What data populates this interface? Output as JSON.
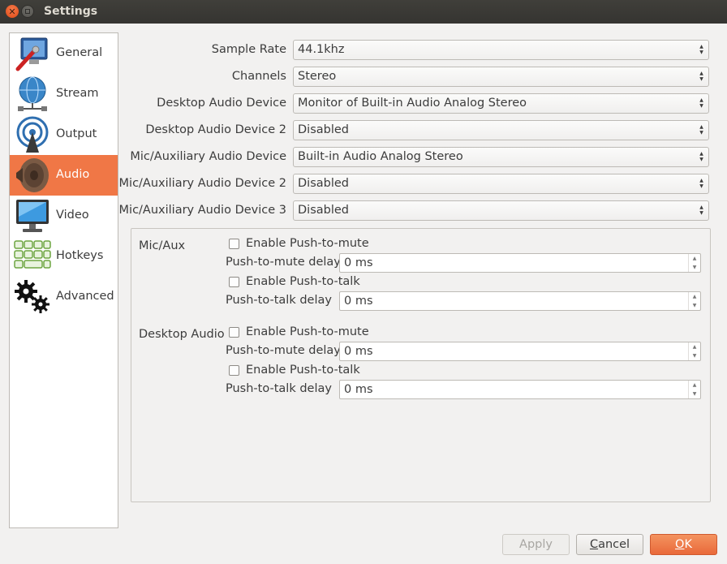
{
  "window": {
    "title": "Settings"
  },
  "sidebar": {
    "items": [
      {
        "label": "General",
        "icon": "monitor-wrench-icon",
        "active": false
      },
      {
        "label": "Stream",
        "icon": "globe-network-icon",
        "active": false
      },
      {
        "label": "Output",
        "icon": "broadcast-antenna-icon",
        "active": false
      },
      {
        "label": "Audio",
        "icon": "speaker-icon",
        "active": true
      },
      {
        "label": "Video",
        "icon": "display-monitor-icon",
        "active": false
      },
      {
        "label": "Hotkeys",
        "icon": "keyboard-grid-icon",
        "active": false
      },
      {
        "label": "Advanced",
        "icon": "gears-icon",
        "active": false
      }
    ]
  },
  "audio": {
    "fields": [
      {
        "label": "Sample Rate",
        "value": "44.1khz"
      },
      {
        "label": "Channels",
        "value": "Stereo"
      },
      {
        "label": "Desktop Audio Device",
        "value": "Monitor of Built-in Audio Analog Stereo"
      },
      {
        "label": "Desktop Audio Device 2",
        "value": "Disabled"
      },
      {
        "label": "Mic/Auxiliary Audio Device",
        "value": "Built-in Audio Analog Stereo"
      },
      {
        "label": "Mic/Auxiliary Audio Device 2",
        "value": "Disabled"
      },
      {
        "label": "Mic/Auxiliary Audio Device 3",
        "value": "Disabled"
      }
    ],
    "hotkey_groups": [
      {
        "name": "Mic/Aux",
        "push_to_mute": {
          "label": "Enable Push-to-mute",
          "checked": false
        },
        "push_to_mute_delay": {
          "label": "Push-to-mute delay",
          "value": "0 ms"
        },
        "push_to_talk": {
          "label": "Enable Push-to-talk",
          "checked": false
        },
        "push_to_talk_delay": {
          "label": "Push-to-talk delay",
          "value": "0 ms"
        }
      },
      {
        "name": "Desktop Audio",
        "push_to_mute": {
          "label": "Enable Push-to-mute",
          "checked": false
        },
        "push_to_mute_delay": {
          "label": "Push-to-mute delay",
          "value": "0 ms"
        },
        "push_to_talk": {
          "label": "Enable Push-to-talk",
          "checked": false
        },
        "push_to_talk_delay": {
          "label": "Push-to-talk delay",
          "value": "0 ms"
        }
      }
    ]
  },
  "buttons": {
    "apply": "Apply",
    "cancel_first": "C",
    "cancel_rest": "ancel",
    "ok_first": "O",
    "ok_rest": "K"
  },
  "colors": {
    "accent": "#f07746",
    "close_button": "#e95420"
  }
}
